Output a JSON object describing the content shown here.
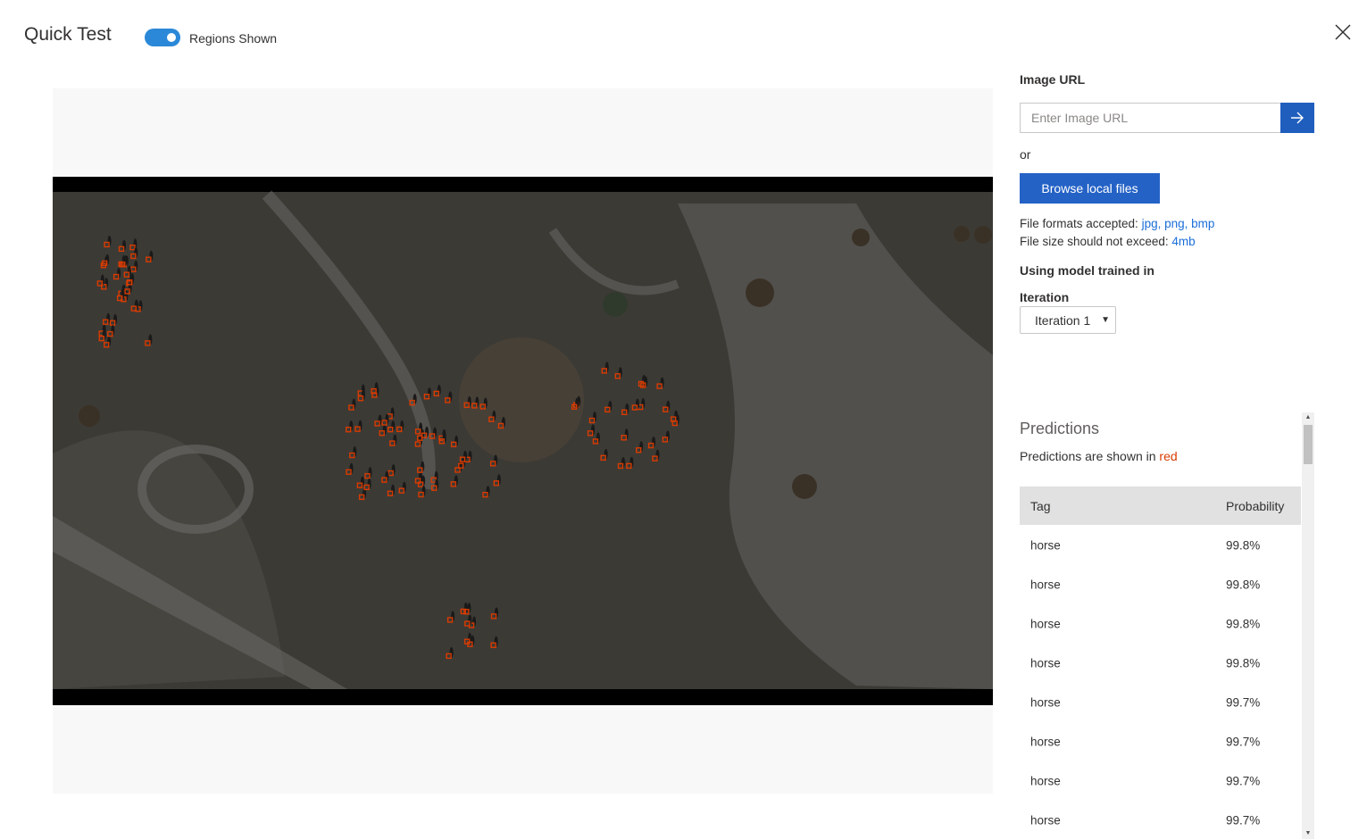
{
  "header": {
    "title": "Quick Test",
    "toggle_label": "Regions Shown",
    "toggle_on": true
  },
  "image_url": {
    "label": "Image URL",
    "placeholder": "Enter Image URL",
    "value": ""
  },
  "or_text": "or",
  "browse_label": "Browse local files",
  "file_info": {
    "formats_prefix": "File formats accepted:",
    "formats": "jpg, png, bmp",
    "size_prefix": "File size should not exceed:",
    "size": "4mb"
  },
  "model": {
    "heading": "Using model trained in",
    "iteration_label": "Iteration",
    "iteration_value": "Iteration 1"
  },
  "predictions": {
    "title": "Predictions",
    "note_prefix": "Predictions are shown in",
    "note_color_word": "red",
    "columns": [
      "Tag",
      "Probability"
    ],
    "rows": [
      {
        "tag": "horse",
        "prob": "99.8%"
      },
      {
        "tag": "horse",
        "prob": "99.8%"
      },
      {
        "tag": "horse",
        "prob": "99.8%"
      },
      {
        "tag": "horse",
        "prob": "99.8%"
      },
      {
        "tag": "horse",
        "prob": "99.7%"
      },
      {
        "tag": "horse",
        "prob": "99.7%"
      },
      {
        "tag": "horse",
        "prob": "99.7%"
      },
      {
        "tag": "horse",
        "prob": "99.7%"
      }
    ]
  },
  "colors": {
    "accent": "#2462c6",
    "toggle": "#2b88d8",
    "prediction": "#d83b01"
  }
}
